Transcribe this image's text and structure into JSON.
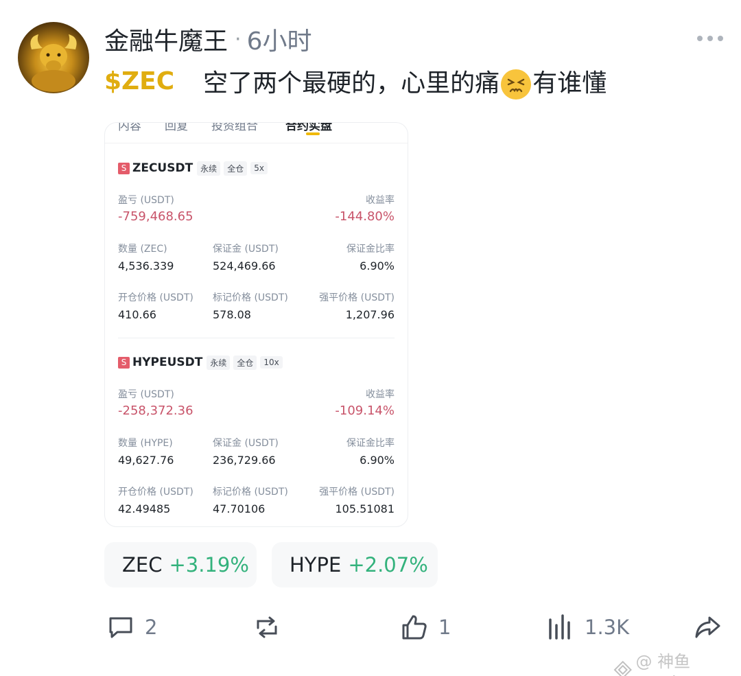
{
  "post": {
    "author": "金融牛魔王",
    "separator": "·",
    "time": "6小时",
    "ticker": "$ZEC",
    "text_before_emoji": "空了两个最硬的，心里的痛",
    "emoji": "persevering-face-icon",
    "text_after_emoji": "有谁懂"
  },
  "card": {
    "tabs": [
      "内容",
      "回复",
      "投资组合",
      "合约实盘"
    ],
    "active_tab": "合约实盘",
    "positions": [
      {
        "badge": "S",
        "symbol": "ZECUSDT",
        "tags": [
          "永续",
          "全仓",
          "5x"
        ],
        "pnl_label": "盈亏 (USDT)",
        "pnl": "-759,468.65",
        "roe_label": "收益率",
        "roe": "-144.80%",
        "qty_label": "数量 (ZEC)",
        "qty": "4,536.339",
        "margin_label": "保证金 (USDT)",
        "margin": "524,469.66",
        "margin_ratio_label": "保证金比率",
        "margin_ratio": "6.90%",
        "entry_label": "开仓价格 (USDT)",
        "entry": "410.66",
        "mark_label": "标记价格 (USDT)",
        "mark": "578.08",
        "liq_label": "强平价格 (USDT)",
        "liq": "1,207.96"
      },
      {
        "badge": "S",
        "symbol": "HYPEUSDT",
        "tags": [
          "永续",
          "全仓",
          "10x"
        ],
        "pnl_label": "盈亏 (USDT)",
        "pnl": "-258,372.36",
        "roe_label": "收益率",
        "roe": "-109.14%",
        "qty_label": "数量 (HYPE)",
        "qty": "49,627.76",
        "margin_label": "保证金 (USDT)",
        "margin": "236,729.66",
        "margin_ratio_label": "保证金比率",
        "margin_ratio": "6.90%",
        "entry_label": "开仓价格 (USDT)",
        "entry": "42.49485",
        "mark_label": "标记价格 (USDT)",
        "mark": "47.70106",
        "liq_label": "强平价格 (USDT)",
        "liq": "105.51081"
      }
    ]
  },
  "chips": [
    {
      "symbol": "ZEC",
      "change": "+3.19%"
    },
    {
      "symbol": "HYPE",
      "change": "+2.07%"
    }
  ],
  "actions": {
    "comments": "2",
    "reposts": "",
    "likes": "1",
    "views": "1.3K"
  },
  "watermark": "@ 神鱼crypto",
  "colors": {
    "ticker": "#e0ad10",
    "negative": "#c8546a",
    "positive": "#33b27c",
    "accent": "#f0b90b"
  }
}
